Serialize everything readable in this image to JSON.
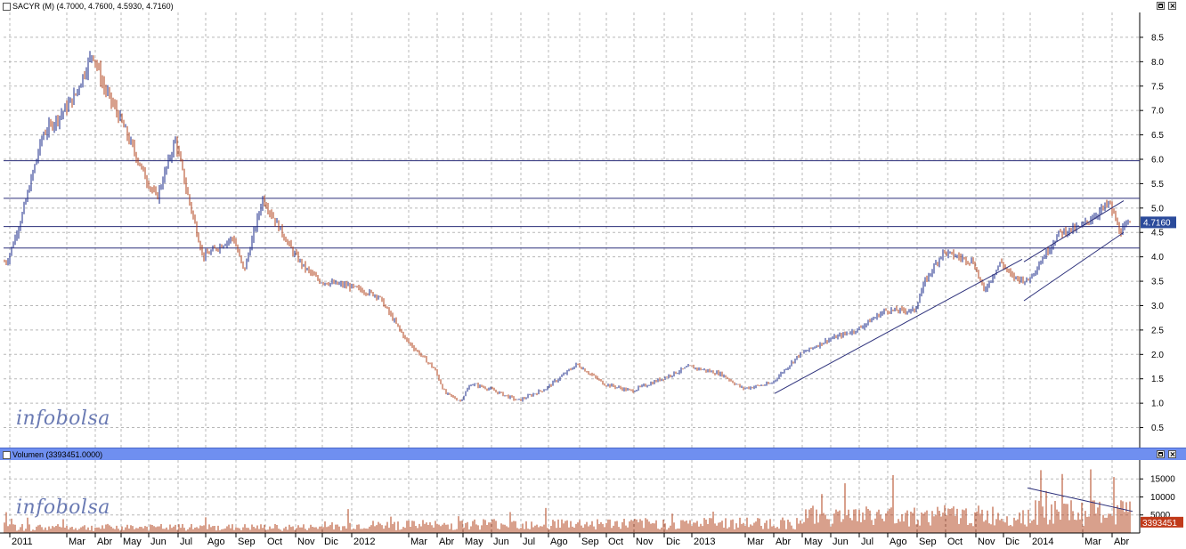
{
  "price_panel": {
    "title": "SACYR (M) (4.7000, 4.7600, 4.5930, 4.7160)",
    "last_price_label": "4.7160",
    "brand": "infobolsa"
  },
  "volume_panel": {
    "title": "Volumen (3393451.0000)",
    "last_volume_label": "3393451",
    "brand": "infobolsa"
  },
  "colors": {
    "up_bar": "#1a2a8a",
    "down_bar": "#b2401a",
    "volume_bar": "#b2401a",
    "grid": "#b8b8b8",
    "support_line": "#2b2f7a",
    "price_tag_bg": "#2b4b9b",
    "volume_tag_bg": "#c03a1a"
  },
  "chart_data": [
    {
      "type": "candlestick",
      "title": "SACYR (M) (4.7000, 4.7600, 4.5930, 4.7160)",
      "x_axis_labels": [
        "2011",
        "Mar",
        "Abr",
        "May",
        "Jun",
        "Jul",
        "Ago",
        "Sep",
        "Oct",
        "Nov",
        "Dic",
        "2012",
        "Mar",
        "Abr",
        "May",
        "Jun",
        "Jul",
        "Ago",
        "Sep",
        "Oct",
        "Nov",
        "Dic",
        "2013",
        "Mar",
        "Abr",
        "May",
        "Jun",
        "Jul",
        "Ago",
        "Sep",
        "Oct",
        "Nov",
        "Dic",
        "2014",
        "Mar",
        "Abr"
      ],
      "y_ticks": [
        0.5,
        1.0,
        1.5,
        2.0,
        2.5,
        3.0,
        3.5,
        4.0,
        4.5,
        5.0,
        5.5,
        6.0,
        6.5,
        7.0,
        7.5,
        8.0,
        8.5
      ],
      "ylim": [
        0.2,
        8.9
      ],
      "grid": true,
      "last": {
        "open": 4.7,
        "high": 4.76,
        "low": 4.593,
        "close": 4.716
      },
      "horizontal_levels": [
        5.97,
        5.2,
        4.62,
        4.18
      ],
      "trendlines": [
        {
          "from": [
            "Mar 2013",
            1.2
          ],
          "to": [
            "Dic 2013",
            3.95
          ]
        },
        {
          "from": [
            "Dic 2013",
            3.1
          ],
          "to": [
            "Abr 2014",
            4.5
          ]
        },
        {
          "from": [
            "Dic 2013",
            3.9
          ],
          "to": [
            "Abr 2014",
            5.15
          ]
        }
      ],
      "approx_path": [
        [
          "2011",
          3.9
        ],
        [
          "Ene 2011",
          4.8
        ],
        [
          "Feb 2011",
          6.5
        ],
        [
          "Mar 2011",
          7.0
        ],
        [
          "Mar 2011",
          7.3
        ],
        [
          "Abr 2011",
          8.2
        ],
        [
          "Abr 2011",
          7.5
        ],
        [
          "May 2011",
          6.9
        ],
        [
          "Jun 2011",
          5.6
        ],
        [
          "Jun 2011",
          5.2
        ],
        [
          "Jul 2011",
          6.4
        ],
        [
          "Jul 2011",
          5.4
        ],
        [
          "Ago 2011",
          4.0
        ],
        [
          "Sep 2011",
          4.4
        ],
        [
          "Sep 2011",
          3.7
        ],
        [
          "Oct 2011",
          5.2
        ],
        [
          "Nov 2011",
          4.1
        ],
        [
          "Nov 2011",
          3.8
        ],
        [
          "Dic 2011",
          3.5
        ],
        [
          "2012",
          3.4
        ],
        [
          "Feb 2012",
          3.2
        ],
        [
          "Mar 2012",
          2.3
        ],
        [
          "Abr 2012",
          1.7
        ],
        [
          "Abr 2012",
          1.2
        ],
        [
          "May 2012",
          1.05
        ],
        [
          "May 2012",
          1.4
        ],
        [
          "Jun 2012",
          1.3
        ],
        [
          "Jul 2012",
          1.05
        ],
        [
          "Ago 2012",
          1.3
        ],
        [
          "Sep 2012",
          1.8
        ],
        [
          "Oct 2012",
          1.4
        ],
        [
          "Nov 2012",
          1.25
        ],
        [
          "Dic 2012",
          1.5
        ],
        [
          "2013",
          1.75
        ],
        [
          "Feb 2013",
          1.6
        ],
        [
          "Mar 2013",
          1.3
        ],
        [
          "Abr 2013",
          1.4
        ],
        [
          "May 2013",
          2.0
        ],
        [
          "Jun 2013",
          2.3
        ],
        [
          "Jul 2013",
          2.5
        ],
        [
          "Ago 2013",
          2.9
        ],
        [
          "Sep 2013",
          2.9
        ],
        [
          "Sep 2013",
          3.5
        ],
        [
          "Oct 2013",
          4.1
        ],
        [
          "Nov 2013",
          3.9
        ],
        [
          "Nov 2013",
          3.3
        ],
        [
          "Dic 2013",
          3.9
        ],
        [
          "Dic 2013",
          3.6
        ],
        [
          "2014",
          3.5
        ],
        [
          "Feb 2014",
          4.5
        ],
        [
          "Mar 2014",
          4.6
        ],
        [
          "Abr 2014",
          5.1
        ],
        [
          "Abr 2014",
          4.5
        ],
        [
          "Abr 2014",
          4.716
        ]
      ]
    },
    {
      "type": "bar",
      "title": "Volumen (3393451.0000)",
      "y_ticks": [
        5000,
        10000,
        15000
      ],
      "ylim": [
        0,
        19500
      ],
      "last_value": 3393451,
      "approx_level_by_segment": [
        {
          "from": "2011",
          "to": "Dic 2011",
          "typical": 1800,
          "peak": 4500
        },
        {
          "from": "2012",
          "to": "Abr 2012",
          "typical": 2500,
          "peak": 5000
        },
        {
          "from": "May 2012",
          "to": "Dic 2012",
          "typical": 3000,
          "peak": 10000
        },
        {
          "from": "2013",
          "to": "Abr 2013",
          "typical": 3200,
          "peak": 8000
        },
        {
          "from": "May 2013",
          "to": "Dic 2013",
          "typical": 5500,
          "peak": 18000
        },
        {
          "from": "2014",
          "to": "Abr 2014",
          "typical": 6500,
          "peak": 19000
        }
      ],
      "trendline": {
        "from": [
          "Dic 2013",
          12500
        ],
        "to": [
          "Abr 2014",
          6000
        ]
      }
    }
  ]
}
